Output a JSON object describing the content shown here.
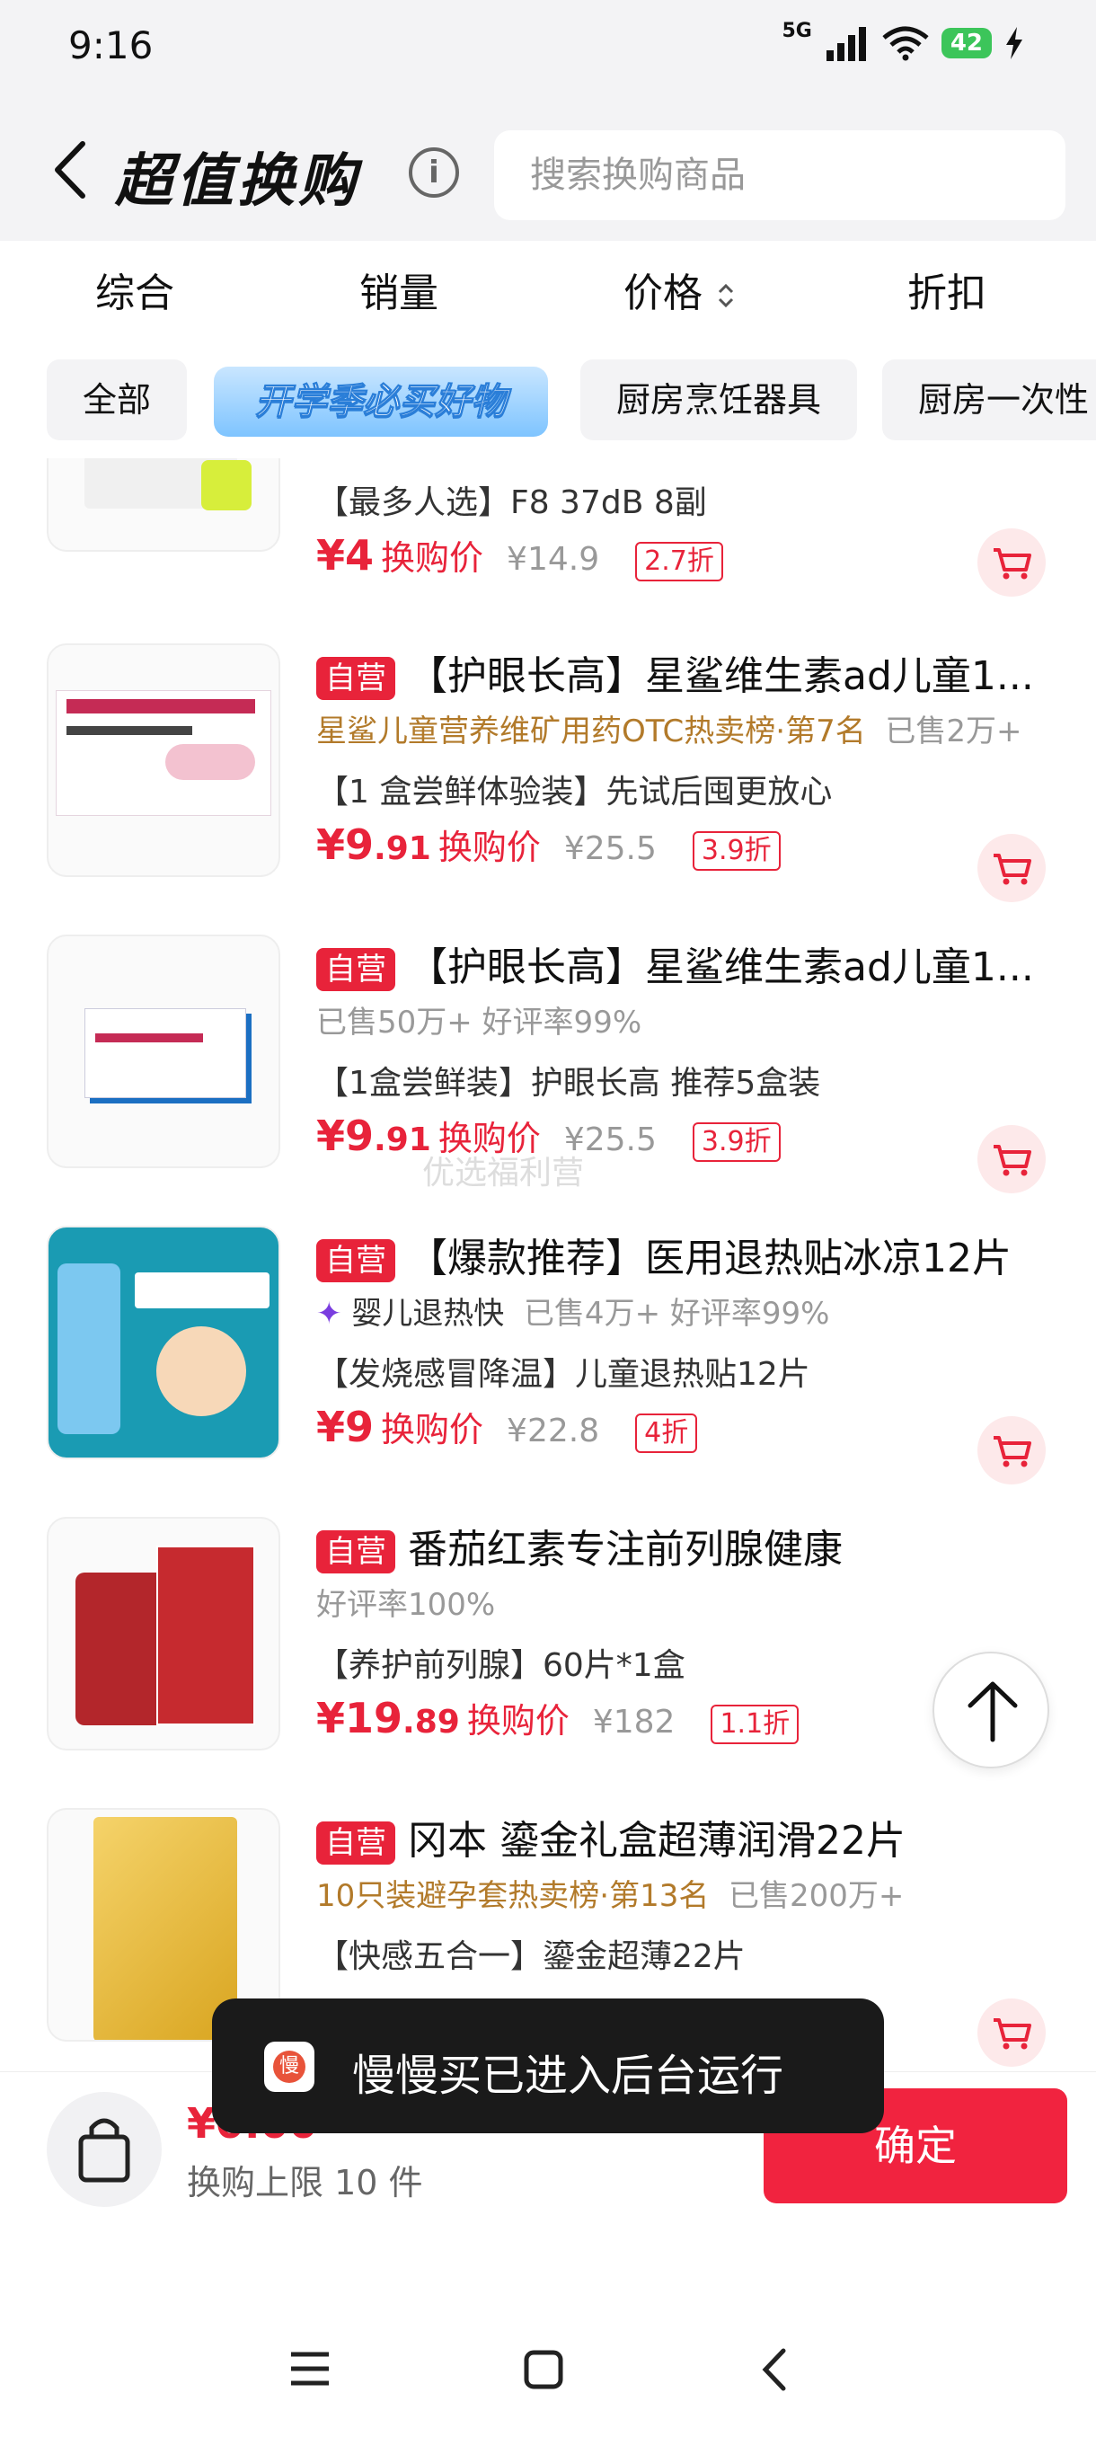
{
  "status_bar": {
    "time": "9:16",
    "network": "5G",
    "battery": "42"
  },
  "header": {
    "title": "超值换购",
    "search_placeholder": "搜索换购商品"
  },
  "sort_tabs": [
    "综合",
    "销量",
    "价格",
    "折扣"
  ],
  "chips": {
    "all": "全部",
    "promo": "开学季必买好物",
    "c1": "厨房烹饪器具",
    "c2": "厨房一次性"
  },
  "products": [
    {
      "subtitle": "【最多人选】F8 37dB 8副",
      "price_int": "4",
      "price_dec": "",
      "price_label": "换购价",
      "original": "¥14.9",
      "discount": "2.7折"
    },
    {
      "tag": "自营",
      "name": "【护眼长高】星鲨维生素ad儿童1...",
      "rank": "星鲨儿童营养维矿用药OTC热卖榜·第7名",
      "sold": "已售2万+",
      "subtitle": "【1 盒尝鲜体验装】先试后囤更放心",
      "price_int": "9",
      "price_dec": ".91",
      "price_label": "换购价",
      "original": "¥25.5",
      "discount": "3.9折"
    },
    {
      "tag": "自营",
      "name": "【护眼长高】星鲨维生素ad儿童1...",
      "meta": "已售50万+  好评率99%",
      "subtitle": "【1盒尝鲜装】护眼长高 推荐5盒装",
      "price_int": "9",
      "price_dec": ".91",
      "price_label": "换购价",
      "original": "¥25.5",
      "discount": "3.9折"
    },
    {
      "tag": "自营",
      "name": "【爆款推荐】医用退热贴冰凉12片",
      "feature": "婴儿退热快",
      "meta": "已售4万+  好评率99%",
      "subtitle": "【发烧感冒降温】儿童退热贴12片",
      "price_int": "9",
      "price_dec": "",
      "price_label": "换购价",
      "original": "¥22.8",
      "discount": "4折"
    },
    {
      "tag": "自营",
      "name": "番茄红素专注前列腺健康",
      "meta": "好评率100%",
      "subtitle": "【养护前列腺】60片*1盒",
      "price_int": "19",
      "price_dec": ".89",
      "price_label": "换购价",
      "original": "¥182",
      "discount": "1.1折"
    },
    {
      "tag": "自营",
      "name": "冈本 鎏金礼盒超薄润滑22片",
      "rank": "10只装避孕套热卖榜·第13名",
      "sold": "已售200万+",
      "subtitle": "【快感五合一】鎏金超薄22片"
    }
  ],
  "watermark": "优选福利营",
  "bottom": {
    "total": "¥0.00",
    "limit": "换购上限 10 件",
    "confirm": "确定"
  },
  "toast": "慢慢买已进入后台运行",
  "colors": {
    "accent": "#e8233a",
    "background": "#f3f3f5"
  }
}
